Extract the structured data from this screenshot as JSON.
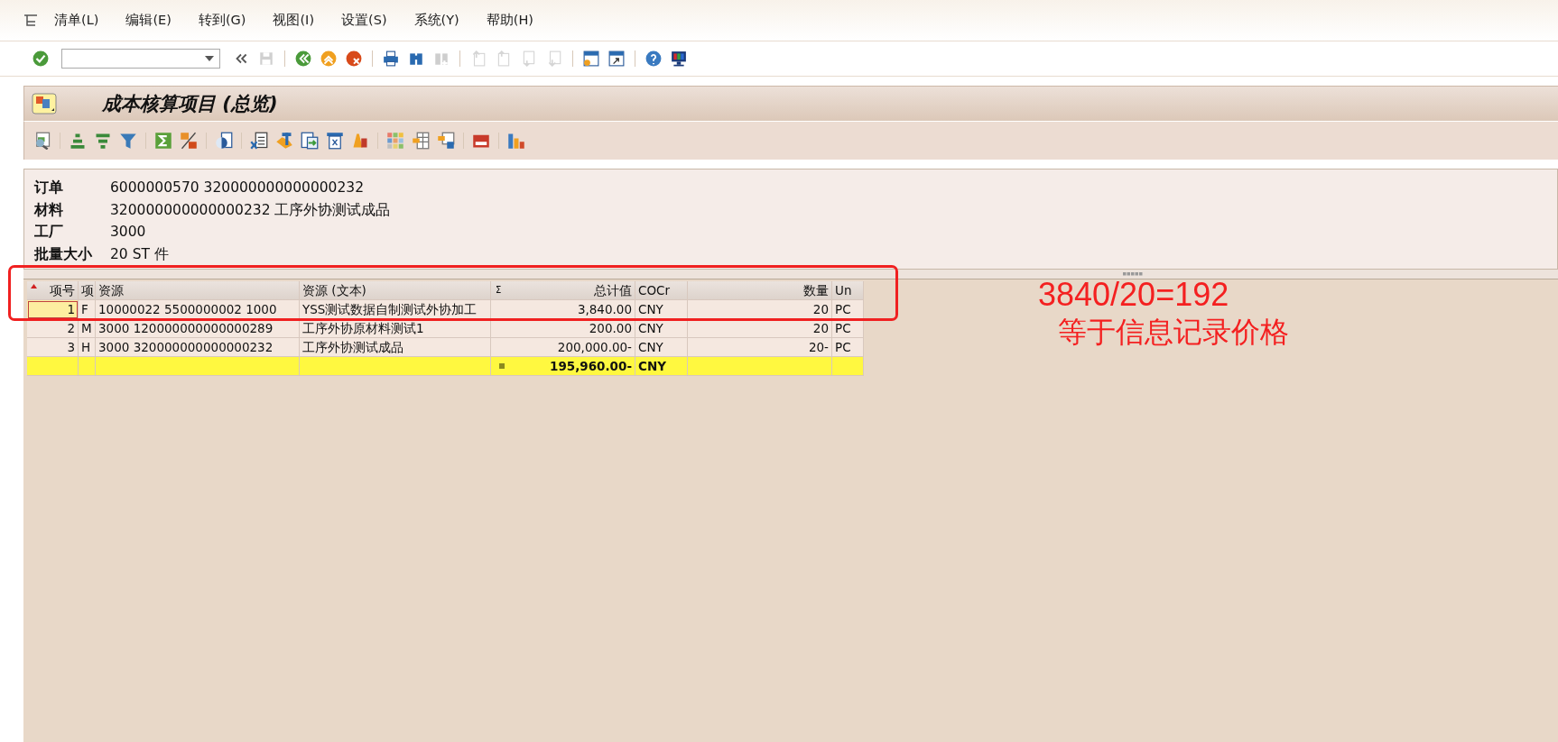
{
  "menu_bar": [
    {
      "label": "清单(L)"
    },
    {
      "label": "编辑(E)"
    },
    {
      "label": "转到(G)"
    },
    {
      "label": "视图(I)"
    },
    {
      "label": "设置(S)"
    },
    {
      "label": "系统(Y)"
    },
    {
      "label": "帮助(H)"
    }
  ],
  "standard_toolbar": [
    {
      "buttons": [
        {
          "kind": "enter",
          "disabled": false
        },
        {
          "kind": "command-field",
          "disabled": false
        },
        {
          "kind": "collapse",
          "disabled": false
        },
        {
          "kind": "save",
          "disabled": true
        }
      ]
    },
    {
      "buttons": [
        {
          "kind": "back",
          "disabled": false
        },
        {
          "kind": "exit",
          "disabled": false
        },
        {
          "kind": "cancel",
          "disabled": false
        }
      ]
    },
    {
      "buttons": [
        {
          "kind": "print",
          "disabled": false
        },
        {
          "kind": "find",
          "disabled": false
        },
        {
          "kind": "find-next",
          "disabled": true
        }
      ]
    },
    {
      "buttons": [
        {
          "kind": "first-page",
          "disabled": true
        },
        {
          "kind": "prev-page",
          "disabled": true
        },
        {
          "kind": "next-page",
          "disabled": true
        },
        {
          "kind": "last-page",
          "disabled": true
        }
      ]
    },
    {
      "buttons": [
        {
          "kind": "new-session",
          "disabled": false
        },
        {
          "kind": "shortcut",
          "disabled": false
        }
      ]
    },
    {
      "buttons": [
        {
          "kind": "help",
          "disabled": false
        },
        {
          "kind": "monitor",
          "disabled": false
        }
      ]
    }
  ],
  "window": {
    "title": "成本核算项目 (总览)"
  },
  "app_toolbar": [
    {
      "kind": "details"
    },
    {
      "kind": "sep"
    },
    {
      "kind": "sort-asc"
    },
    {
      "kind": "sort-desc"
    },
    {
      "kind": "filter"
    },
    {
      "kind": "sep"
    },
    {
      "kind": "sum"
    },
    {
      "kind": "subtotal"
    },
    {
      "kind": "sep"
    },
    {
      "kind": "view"
    },
    {
      "kind": "sep"
    },
    {
      "kind": "spreadsheet"
    },
    {
      "kind": "word"
    },
    {
      "kind": "export"
    },
    {
      "kind": "column"
    },
    {
      "kind": "abc"
    },
    {
      "kind": "sep"
    },
    {
      "kind": "layout"
    },
    {
      "kind": "layout-select"
    },
    {
      "kind": "layout-save"
    },
    {
      "kind": "sep"
    },
    {
      "kind": "currency"
    },
    {
      "kind": "sep"
    },
    {
      "kind": "chart"
    }
  ],
  "header": [
    {
      "label": "订单",
      "value": "6000000570 320000000000000232"
    },
    {
      "label": "材料",
      "value": "320000000000000232 工序外协测试成品"
    },
    {
      "label": "工厂",
      "value": "3000"
    },
    {
      "label": "批量大小",
      "value": "20 ST 件"
    }
  ],
  "table": {
    "columns": [
      {
        "label": "项号"
      },
      {
        "label": "项"
      },
      {
        "label": "资源"
      },
      {
        "label": "资源 (文本)"
      },
      {
        "label": "总计值",
        "sum_mark": "Σ"
      },
      {
        "label": "COCr"
      },
      {
        "label": "数量"
      },
      {
        "label": "Un"
      }
    ],
    "rows": [
      {
        "selected": true,
        "cells": [
          "1",
          "F",
          "10000022    5500000002 1000",
          "YSS测试数据自制测试外协加工",
          "3,840.00",
          "CNY",
          "20",
          "PC"
        ]
      },
      {
        "selected": false,
        "cells": [
          "2",
          "M",
          "3000 120000000000000289",
          "工序外协原材料测试1",
          "200.00",
          "CNY",
          "20",
          "PC"
        ]
      },
      {
        "selected": false,
        "cells": [
          "3",
          "H",
          "3000 320000000000000232",
          "工序外协测试成品",
          "200,000.00-",
          "CNY",
          "20-",
          "PC"
        ]
      }
    ],
    "total": {
      "value": "195,960.00-",
      "currency": "CNY"
    }
  },
  "annotation": {
    "formula": "3840/20=192",
    "note": "等于信息记录价格"
  }
}
